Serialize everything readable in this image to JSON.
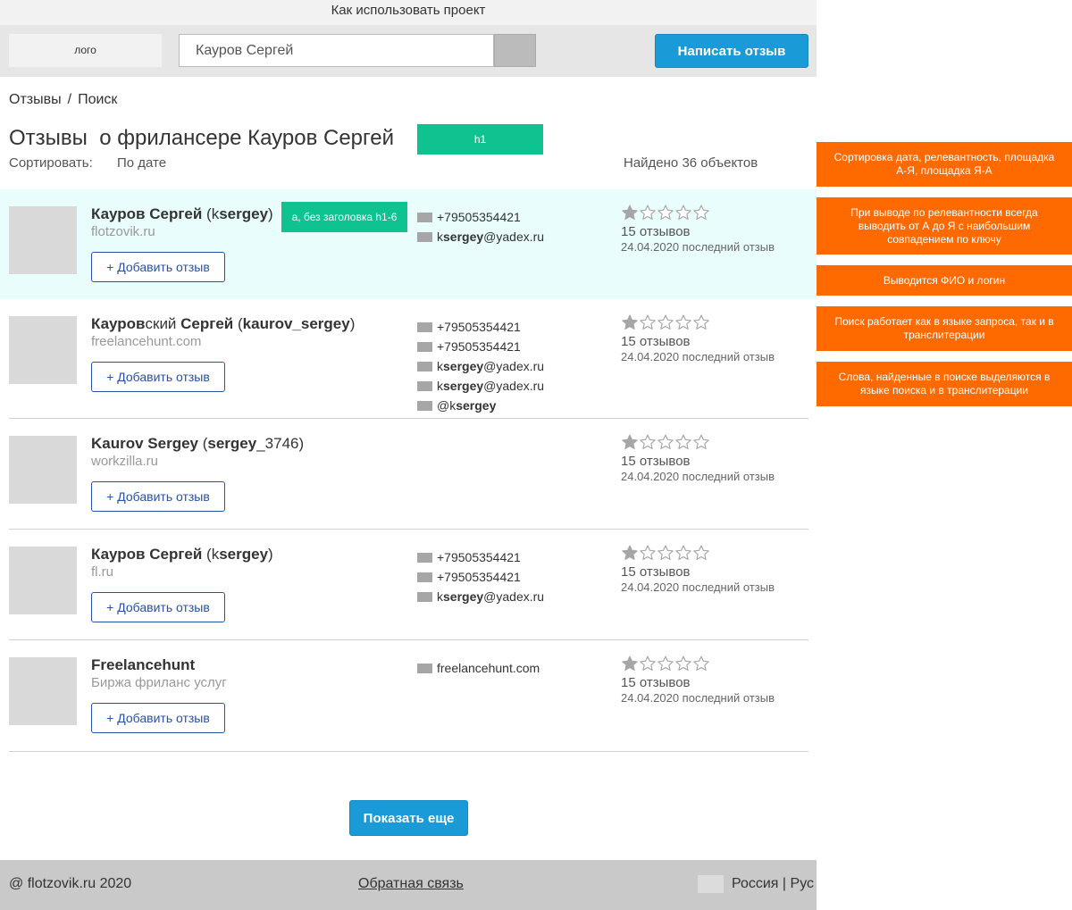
{
  "topbar": {
    "how_to_use": "Как использовать проект"
  },
  "header": {
    "logo": "лого",
    "search_value": "Кауров Сергей",
    "write_review": "Написать отзыв"
  },
  "breadcrumb": {
    "items": [
      "Отзывы",
      "Поиск"
    ],
    "separator": "/"
  },
  "title": {
    "text": "Отзывы  о фрилансере Кауров Сергей",
    "h1_tag": "h1",
    "sort_label": "Сортировать:",
    "sort_value": "По дате",
    "found": "Найдено 36 объектов"
  },
  "results": [
    {
      "name_parts": [
        {
          "t": "Кауров Сергей",
          "b": true
        },
        {
          "t": " (k",
          "b": false
        },
        {
          "t": "sergey",
          "b": true
        },
        {
          "t": ")",
          "b": false
        }
      ],
      "site": "flotzovik.ru",
      "add_label": "+ Добавить отзыв",
      "note": "a, без заголовка h1-6",
      "contacts": [
        {
          "parts": [
            {
              "t": "+79505354421",
              "b": false
            }
          ]
        },
        {
          "parts": [
            {
              "t": "k",
              "b": false
            },
            {
              "t": "sergey",
              "b": true
            },
            {
              "t": "@yadex.ru",
              "b": false
            }
          ]
        }
      ],
      "rating": 1,
      "reviews": "15 отзывов",
      "last_review": "24.04.2020 последний отзыв"
    },
    {
      "name_parts": [
        {
          "t": "Кауров",
          "b": true
        },
        {
          "t": "ский ",
          "b": false
        },
        {
          "t": "Сергей",
          "b": true
        },
        {
          "t": " (",
          "b": false
        },
        {
          "t": "kaurov_sergey",
          "b": true
        },
        {
          "t": ")",
          "b": false
        }
      ],
      "site": "freelancehunt.com",
      "add_label": "+ Добавить отзыв",
      "contacts": [
        {
          "parts": [
            {
              "t": "+79505354421",
              "b": false
            }
          ]
        },
        {
          "parts": [
            {
              "t": "+79505354421",
              "b": false
            }
          ]
        },
        {
          "parts": [
            {
              "t": "k",
              "b": false
            },
            {
              "t": "sergey",
              "b": true
            },
            {
              "t": "@yadex.ru",
              "b": false
            }
          ]
        },
        {
          "parts": [
            {
              "t": "k",
              "b": false
            },
            {
              "t": "sergey",
              "b": true
            },
            {
              "t": "@yadex.ru",
              "b": false
            }
          ]
        },
        {
          "parts": [
            {
              "t": "@k",
              "b": false
            },
            {
              "t": "sergey",
              "b": true
            }
          ]
        }
      ],
      "rating": 1,
      "reviews": "15 отзывов",
      "last_review": "24.04.2020 последний отзыв"
    },
    {
      "name_parts": [
        {
          "t": "Kaurov Sergey",
          "b": true
        },
        {
          "t": " (",
          "b": false
        },
        {
          "t": "sergey",
          "b": true
        },
        {
          "t": "_3746)",
          "b": false
        }
      ],
      "site": "workzilla.ru",
      "add_label": "+ Добавить отзыв",
      "contacts": [],
      "rating": 1,
      "reviews": "15 отзывов",
      "last_review": "24.04.2020 последний отзыв"
    },
    {
      "name_parts": [
        {
          "t": "Кауров Сергей",
          "b": true
        },
        {
          "t": " (k",
          "b": false
        },
        {
          "t": "sergey",
          "b": true
        },
        {
          "t": ")",
          "b": false
        }
      ],
      "site": "fl.ru",
      "add_label": "+ Добавить отзыв",
      "contacts": [
        {
          "parts": [
            {
              "t": "+79505354421",
              "b": false
            }
          ]
        },
        {
          "parts": [
            {
              "t": "+79505354421",
              "b": false
            }
          ]
        },
        {
          "parts": [
            {
              "t": "k",
              "b": false
            },
            {
              "t": "sergey",
              "b": true
            },
            {
              "t": "@yadex.ru",
              "b": false
            }
          ]
        }
      ],
      "rating": 1,
      "reviews": "15 отзывов",
      "last_review": "24.04.2020 последний отзыв"
    },
    {
      "name_parts": [
        {
          "t": "Freelancehunt",
          "b": true
        }
      ],
      "site": "Биржа фриланс услуг",
      "add_label": "+ Добавить отзыв",
      "contacts": [
        {
          "parts": [
            {
              "t": "freelancehunt.com",
              "b": false
            }
          ]
        }
      ],
      "rating": 1,
      "reviews": "15 отзывов",
      "last_review": "24.04.2020 последний отзыв"
    }
  ],
  "show_more": "Показать еще",
  "footer": {
    "copyright": "@ flotzovik.ru 2020",
    "feedback": "Обратная связь",
    "lang": "Россия | Рус"
  },
  "side_notes": [
    "Сортировка дата, релевантность, площадка А-Я, площадка Я-А",
    "При выводе по релевантности всегда выводить от А до Я с наибольшим совпадением по ключу",
    "Выводится ФИО и логин",
    "Поиск работает как в языке запроса, так и в транслитерации",
    "Слова, найденные в поиске выделяются в языке поиска и в транслитерации"
  ],
  "colors": {
    "accent_button": "#1a9bd7",
    "annotation_tag": "#0fc391",
    "side_note": "#ff6a00",
    "highlight_row": "#e8fdfc",
    "link_button": "#2453a6"
  }
}
